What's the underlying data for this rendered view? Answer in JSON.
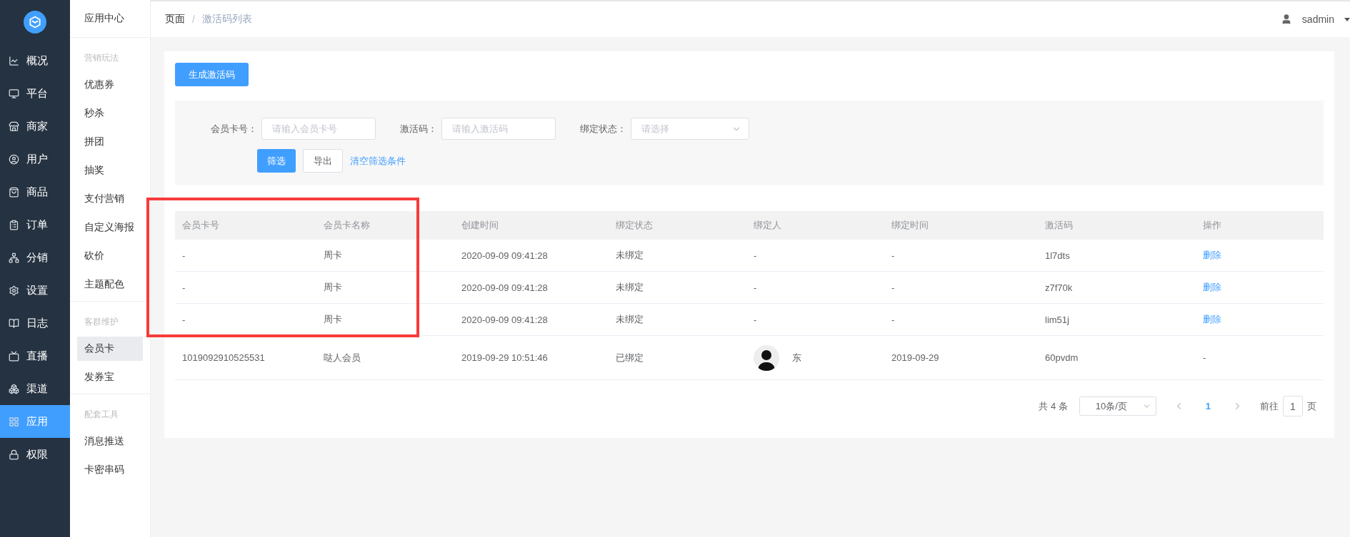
{
  "nav": [
    {
      "label": "概况",
      "selected": false
    },
    {
      "label": "平台",
      "selected": false
    },
    {
      "label": "商家",
      "selected": false
    },
    {
      "label": "用户",
      "selected": false
    },
    {
      "label": "商品",
      "selected": false
    },
    {
      "label": "订单",
      "selected": false
    },
    {
      "label": "分销",
      "selected": false
    },
    {
      "label": "设置",
      "selected": false
    },
    {
      "label": "日志",
      "selected": false
    },
    {
      "label": "直播",
      "selected": false
    },
    {
      "label": "渠道",
      "selected": false
    },
    {
      "label": "应用",
      "selected": true
    },
    {
      "label": "权限",
      "selected": false
    }
  ],
  "submenu": {
    "title": "应用中心",
    "groups": [
      {
        "title": "营销玩法",
        "items": [
          {
            "label": "优惠券",
            "selected": false
          },
          {
            "label": "秒杀",
            "selected": false
          },
          {
            "label": "拼团",
            "selected": false
          },
          {
            "label": "抽奖",
            "selected": false
          },
          {
            "label": "支付营销",
            "selected": false
          },
          {
            "label": "自定义海报",
            "selected": false
          },
          {
            "label": "砍价",
            "selected": false
          },
          {
            "label": "主题配色",
            "selected": false
          }
        ]
      },
      {
        "title": "客群维护",
        "items": [
          {
            "label": "会员卡",
            "selected": true
          },
          {
            "label": "发券宝",
            "selected": false
          }
        ]
      },
      {
        "title": "配套工具",
        "items": [
          {
            "label": "消息推送",
            "selected": false
          },
          {
            "label": "卡密串码",
            "selected": false
          }
        ]
      }
    ]
  },
  "breadcrumb": {
    "items": [
      "页面",
      "激活码列表"
    ],
    "separator": "/"
  },
  "user": {
    "name": "sadmin"
  },
  "generate_button": "生成激活码",
  "filters": [
    {
      "label": "会员卡号：",
      "kind": "input",
      "placeholder": "请输入会员卡号"
    },
    {
      "label": "激活码：",
      "kind": "input",
      "placeholder": "请输入激活码"
    },
    {
      "label": "绑定状态：",
      "kind": "select",
      "placeholder": "请选择"
    }
  ],
  "filter_buttons": {
    "primary": "筛选",
    "secondary": "导出",
    "link": "清空筛选条件"
  },
  "table": {
    "columns": [
      "会员卡号",
      "会员卡名称",
      "创建时间",
      "绑定状态",
      "绑定人",
      "绑定时间",
      "激活码",
      "操作"
    ],
    "rows": [
      {
        "card_no": "-",
        "card_name": "周卡",
        "created": "2020-09-09 09:41:28",
        "status": "未绑定",
        "binder": "-",
        "binder_avatar": false,
        "bound_time": "-",
        "code": "1l7dts",
        "action": {
          "kind": "link",
          "label": "删除"
        }
      },
      {
        "card_no": "-",
        "card_name": "周卡",
        "created": "2020-09-09 09:41:28",
        "status": "未绑定",
        "binder": "-",
        "binder_avatar": false,
        "bound_time": "-",
        "code": "z7f70k",
        "action": {
          "kind": "link",
          "label": "删除"
        }
      },
      {
        "card_no": "-",
        "card_name": "周卡",
        "created": "2020-09-09 09:41:28",
        "status": "未绑定",
        "binder": "-",
        "binder_avatar": false,
        "bound_time": "-",
        "code": "lim51j",
        "action": {
          "kind": "link",
          "label": "删除"
        }
      },
      {
        "card_no": "1019092910525531",
        "card_name": "哒人会员",
        "created": "2019-09-29 10:51:46",
        "status": "已绑定",
        "binder": "东",
        "binder_avatar": true,
        "bound_time": "2019-09-29",
        "code": "60pvdm",
        "action": {
          "kind": "text",
          "label": "-"
        }
      }
    ]
  },
  "pagination": {
    "total": "共 4 条",
    "page_size": "10条/页",
    "pages": [
      {
        "label": "1",
        "selected": true
      }
    ],
    "goto_label": "前往",
    "goto_value": "1",
    "goto_suffix": "页"
  },
  "highlight_frame": {
    "shown": true
  }
}
